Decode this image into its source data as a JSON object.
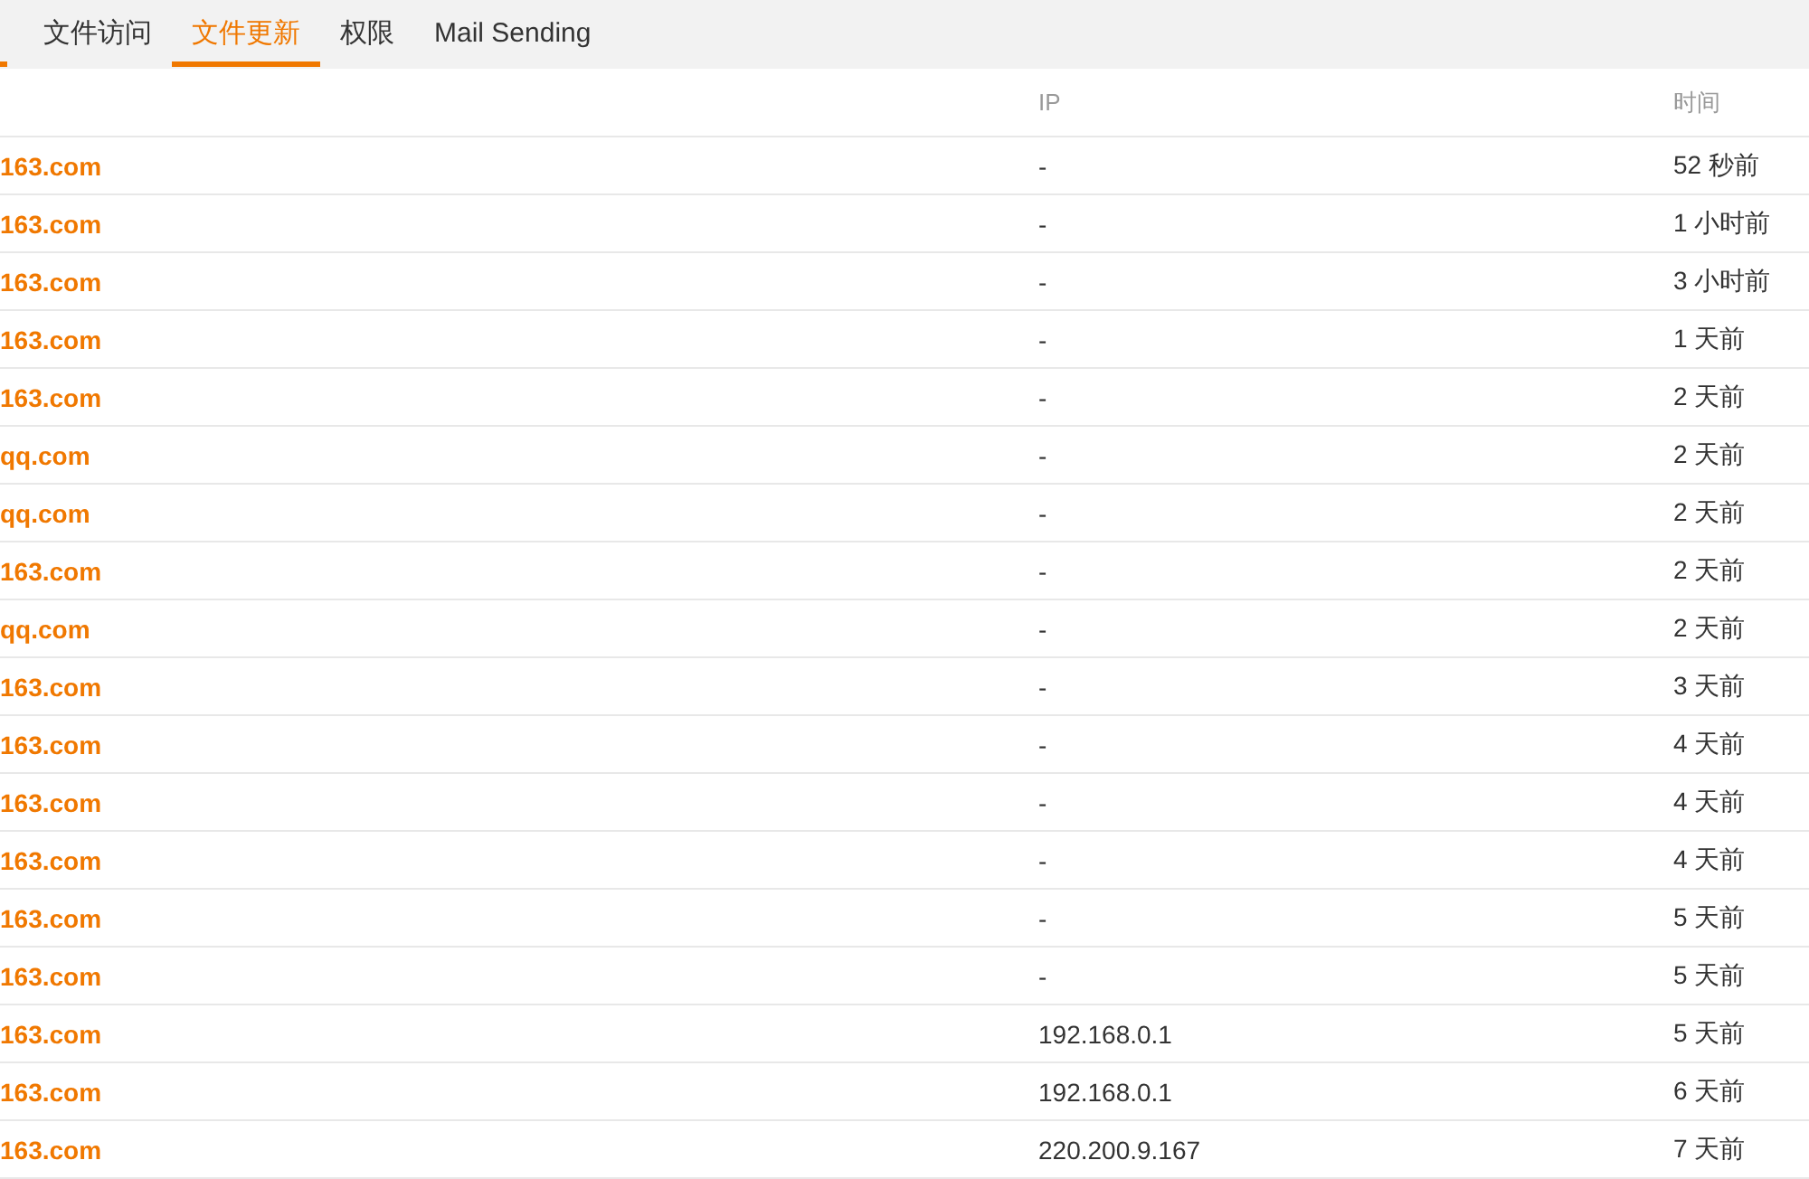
{
  "tabs": [
    {
      "label": "文件访问",
      "selected": false
    },
    {
      "label": "文件更新",
      "selected": true
    },
    {
      "label": "权限",
      "selected": false
    },
    {
      "label": "Mail Sending",
      "selected": false
    }
  ],
  "table": {
    "columns": [
      "IP",
      "时间"
    ],
    "rows": [
      {
        "account": "163.com",
        "ip": "-",
        "time": "52 秒前"
      },
      {
        "account": "163.com",
        "ip": "-",
        "time": "1 小时前"
      },
      {
        "account": "163.com",
        "ip": "-",
        "time": "3 小时前"
      },
      {
        "account": "163.com",
        "ip": "-",
        "time": "1 天前"
      },
      {
        "account": "163.com",
        "ip": "-",
        "time": "2 天前"
      },
      {
        "account": "qq.com",
        "ip": "-",
        "time": "2 天前"
      },
      {
        "account": "qq.com",
        "ip": "-",
        "time": "2 天前"
      },
      {
        "account": "163.com",
        "ip": "-",
        "time": "2 天前"
      },
      {
        "account": "qq.com",
        "ip": "-",
        "time": "2 天前"
      },
      {
        "account": "163.com",
        "ip": "-",
        "time": "3 天前"
      },
      {
        "account": "163.com",
        "ip": "-",
        "time": "4 天前"
      },
      {
        "account": "163.com",
        "ip": "-",
        "time": "4 天前"
      },
      {
        "account": "163.com",
        "ip": "-",
        "time": "4 天前"
      },
      {
        "account": "163.com",
        "ip": "-",
        "time": "5 天前"
      },
      {
        "account": "163.com",
        "ip": "-",
        "time": "5 天前"
      },
      {
        "account": "163.com",
        "ip": "192.168.0.1",
        "time": "5 天前"
      },
      {
        "account": "163.com",
        "ip": "192.168.0.1",
        "time": "6 天前"
      },
      {
        "account": "163.com",
        "ip": "220.200.9.167",
        "time": "7 天前"
      }
    ]
  }
}
